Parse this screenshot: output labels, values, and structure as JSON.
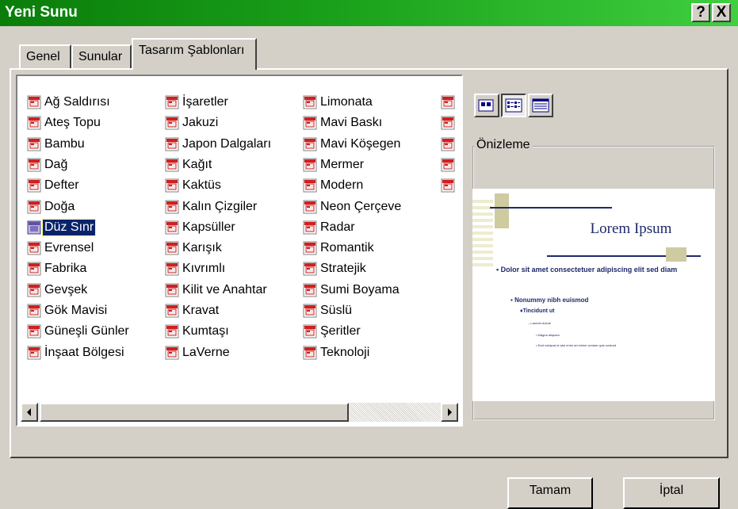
{
  "window": {
    "title": "Yeni Sunu",
    "help_label": "?",
    "close_label": "X"
  },
  "tabs": [
    {
      "label": "Genel"
    },
    {
      "label": "Sunular"
    },
    {
      "label": "Tasarım Şablonları",
      "active": true
    }
  ],
  "templates": {
    "columns": [
      [
        "Ağ Saldırısı",
        "Ateş Topu",
        "Bambu",
        "Dağ",
        "Defter",
        "Doğa",
        "Düz Sınr",
        "Evrensel",
        "Fabrika",
        "Gevşek",
        "Gök Mavisi",
        "Güneşli Günler",
        "İnşaat Bölgesi"
      ],
      [
        "İşaretler",
        "Jakuzi",
        "Japon Dalgaları",
        "Kağıt",
        "Kaktüs",
        "Kalın Çizgiler",
        "Kapsüller",
        "Karışık",
        "Kıvrımlı",
        "Kilit ve Anahtar",
        "Kravat",
        "Kumtaşı",
        "LaVerne"
      ],
      [
        "Limonata",
        "Mavi Baskı",
        "Mavi Köşegen",
        "Mermer",
        "Modern",
        "Neon Çerçeve",
        "Radar",
        "Romantik",
        "Stratejik",
        "Sumi Boyama",
        "Süslü",
        "Şeritler",
        "Teknoloji"
      ]
    ],
    "selected": "Düz Sınr",
    "partial_column_icons": 5,
    "icon": "template-file-icon"
  },
  "view_buttons": [
    {
      "name": "large-icons-view",
      "pressed": false
    },
    {
      "name": "list-view",
      "pressed": true
    },
    {
      "name": "details-view",
      "pressed": false
    }
  ],
  "preview": {
    "label": "Önizleme",
    "slide_title": "Lorem Ipsum",
    "bullets": [
      "Dolor sit amet consectetuer adipiscing elit sed diam",
      "Nonummy nibh euismod",
      "Tincidunt ut",
      "Laoreet dolore",
      "Magna aliquam",
      "Erat volutpat ut wisi enim ad minim veniam quis nostrud"
    ],
    "colors": {
      "accent": "#1f2a6b",
      "bar": "#cfcba0",
      "stripes": "#eeeccf"
    }
  },
  "buttons": {
    "ok_label": "Tamam",
    "cancel_label": "İptal"
  }
}
